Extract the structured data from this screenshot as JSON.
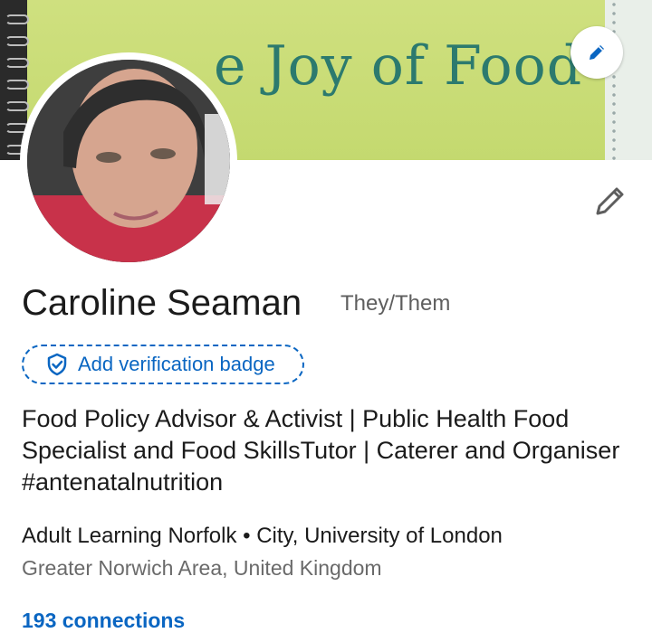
{
  "banner": {
    "text": "e Joy of Food"
  },
  "profile": {
    "name": "Caroline Seaman",
    "pronouns": "They/Them",
    "verification_label": "Add verification badge",
    "headline": "Food Policy Advisor & Activist | Public Health Food Specialist and Food SkillsTutor | Caterer and Organiser #antenatalnutrition",
    "experience": "Adult Learning Norfolk • City, University of London",
    "location": "Greater Norwich Area, United Kingdom",
    "connections": "193 connections"
  },
  "colors": {
    "accent": "#0a66c2",
    "text": "#1b1b1b",
    "secondary": "#6a6a6a",
    "banner": "#c9dd7a"
  },
  "icons": {
    "banner_edit": "pencil-icon",
    "profile_edit": "pencil-icon",
    "verification": "shield-check-icon"
  }
}
